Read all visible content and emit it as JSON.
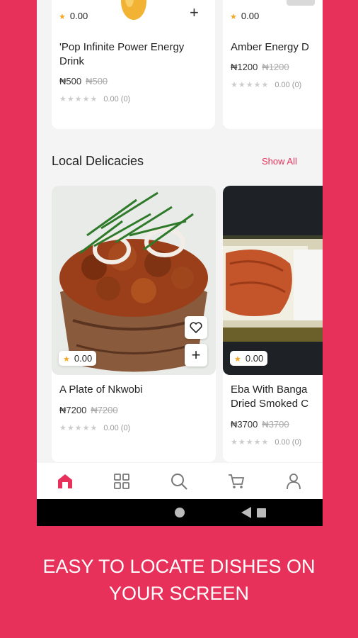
{
  "theme": {
    "accent": "#e8315a",
    "star": "#f5a623"
  },
  "top_cards": [
    {
      "rating": "0.00",
      "name": "'Pop Infinite Power Energy\nDrink",
      "price": "₦500",
      "old_price": "₦500",
      "stars": "★★★★★",
      "reviews": "0.00 (0)"
    },
    {
      "rating": "0.00",
      "name": "Amber Energy D",
      "price": "₦1200",
      "old_price": "₦1200",
      "stars": "★★★★★",
      "reviews": "0.00 (0)"
    }
  ],
  "section": {
    "title": "Local Delicacies",
    "show_all": "Show All"
  },
  "delicacy_cards": [
    {
      "rating": "0.00",
      "name": "A Plate of Nkwobi",
      "price": "₦7200",
      "old_price": "₦7200",
      "stars": "★★★★★",
      "reviews": "0.00 (0)"
    },
    {
      "rating": "0.00",
      "name": "Eba With Banga\nDried Smoked C",
      "price": "₦3700",
      "old_price": "₦3700",
      "stars": "★★★★★",
      "reviews": "0.00 (0)"
    }
  ],
  "bottom_nav": [
    "home-icon",
    "grid-icon",
    "search-icon",
    "cart-icon",
    "profile-icon"
  ],
  "tagline": "EASY TO LOCATE DISHES ON\nYOUR SCREEN"
}
